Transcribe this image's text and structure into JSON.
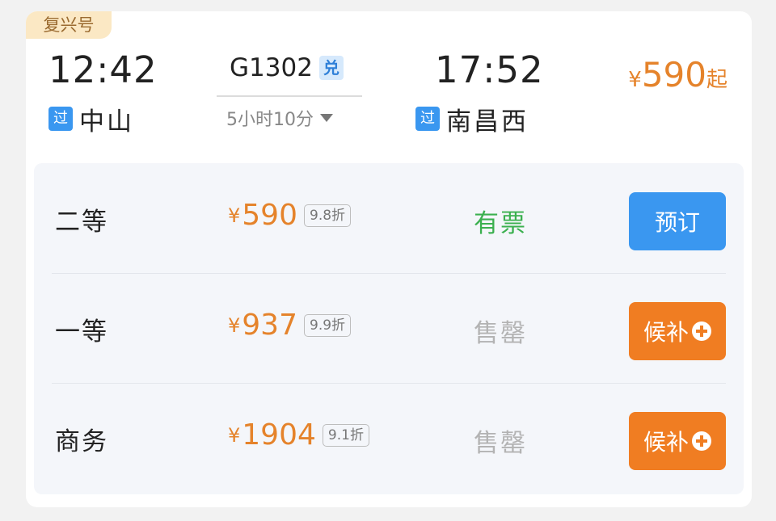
{
  "train": {
    "type_tag": "复兴号",
    "departure_time": "12:42",
    "arrival_time": "17:52",
    "train_number": "G1302",
    "exchange_badge": "兑",
    "duration": "5小时10分",
    "departure": {
      "pass_badge": "过",
      "station": "中山"
    },
    "arrival": {
      "pass_badge": "过",
      "station": "南昌西"
    },
    "min_price": {
      "currency": "¥",
      "amount": "590",
      "suffix": "起"
    }
  },
  "seats": [
    {
      "class": "二等",
      "currency": "¥",
      "price": "590",
      "discount": "9.8折",
      "availability": "有票",
      "availability_color": "#3bb04f",
      "action_label": "预订",
      "action_color": "#3a97f0",
      "action_icon": null
    },
    {
      "class": "一等",
      "currency": "¥",
      "price": "937",
      "discount": "9.9折",
      "availability": "售罄",
      "availability_color": "#b3b3b3",
      "action_label": "候补",
      "action_color": "#f07d22",
      "action_icon": "plus-circle-icon"
    },
    {
      "class": "商务",
      "currency": "¥",
      "price": "1904",
      "discount": "9.1折",
      "availability": "售罄",
      "availability_color": "#b3b3b3",
      "action_label": "候补",
      "action_color": "#f07d22",
      "action_icon": "plus-circle-icon"
    }
  ],
  "colors": {
    "price_orange": "#e5832b",
    "tag_bg": "#fbe8c4",
    "badge_blue": "#3a97f0"
  }
}
